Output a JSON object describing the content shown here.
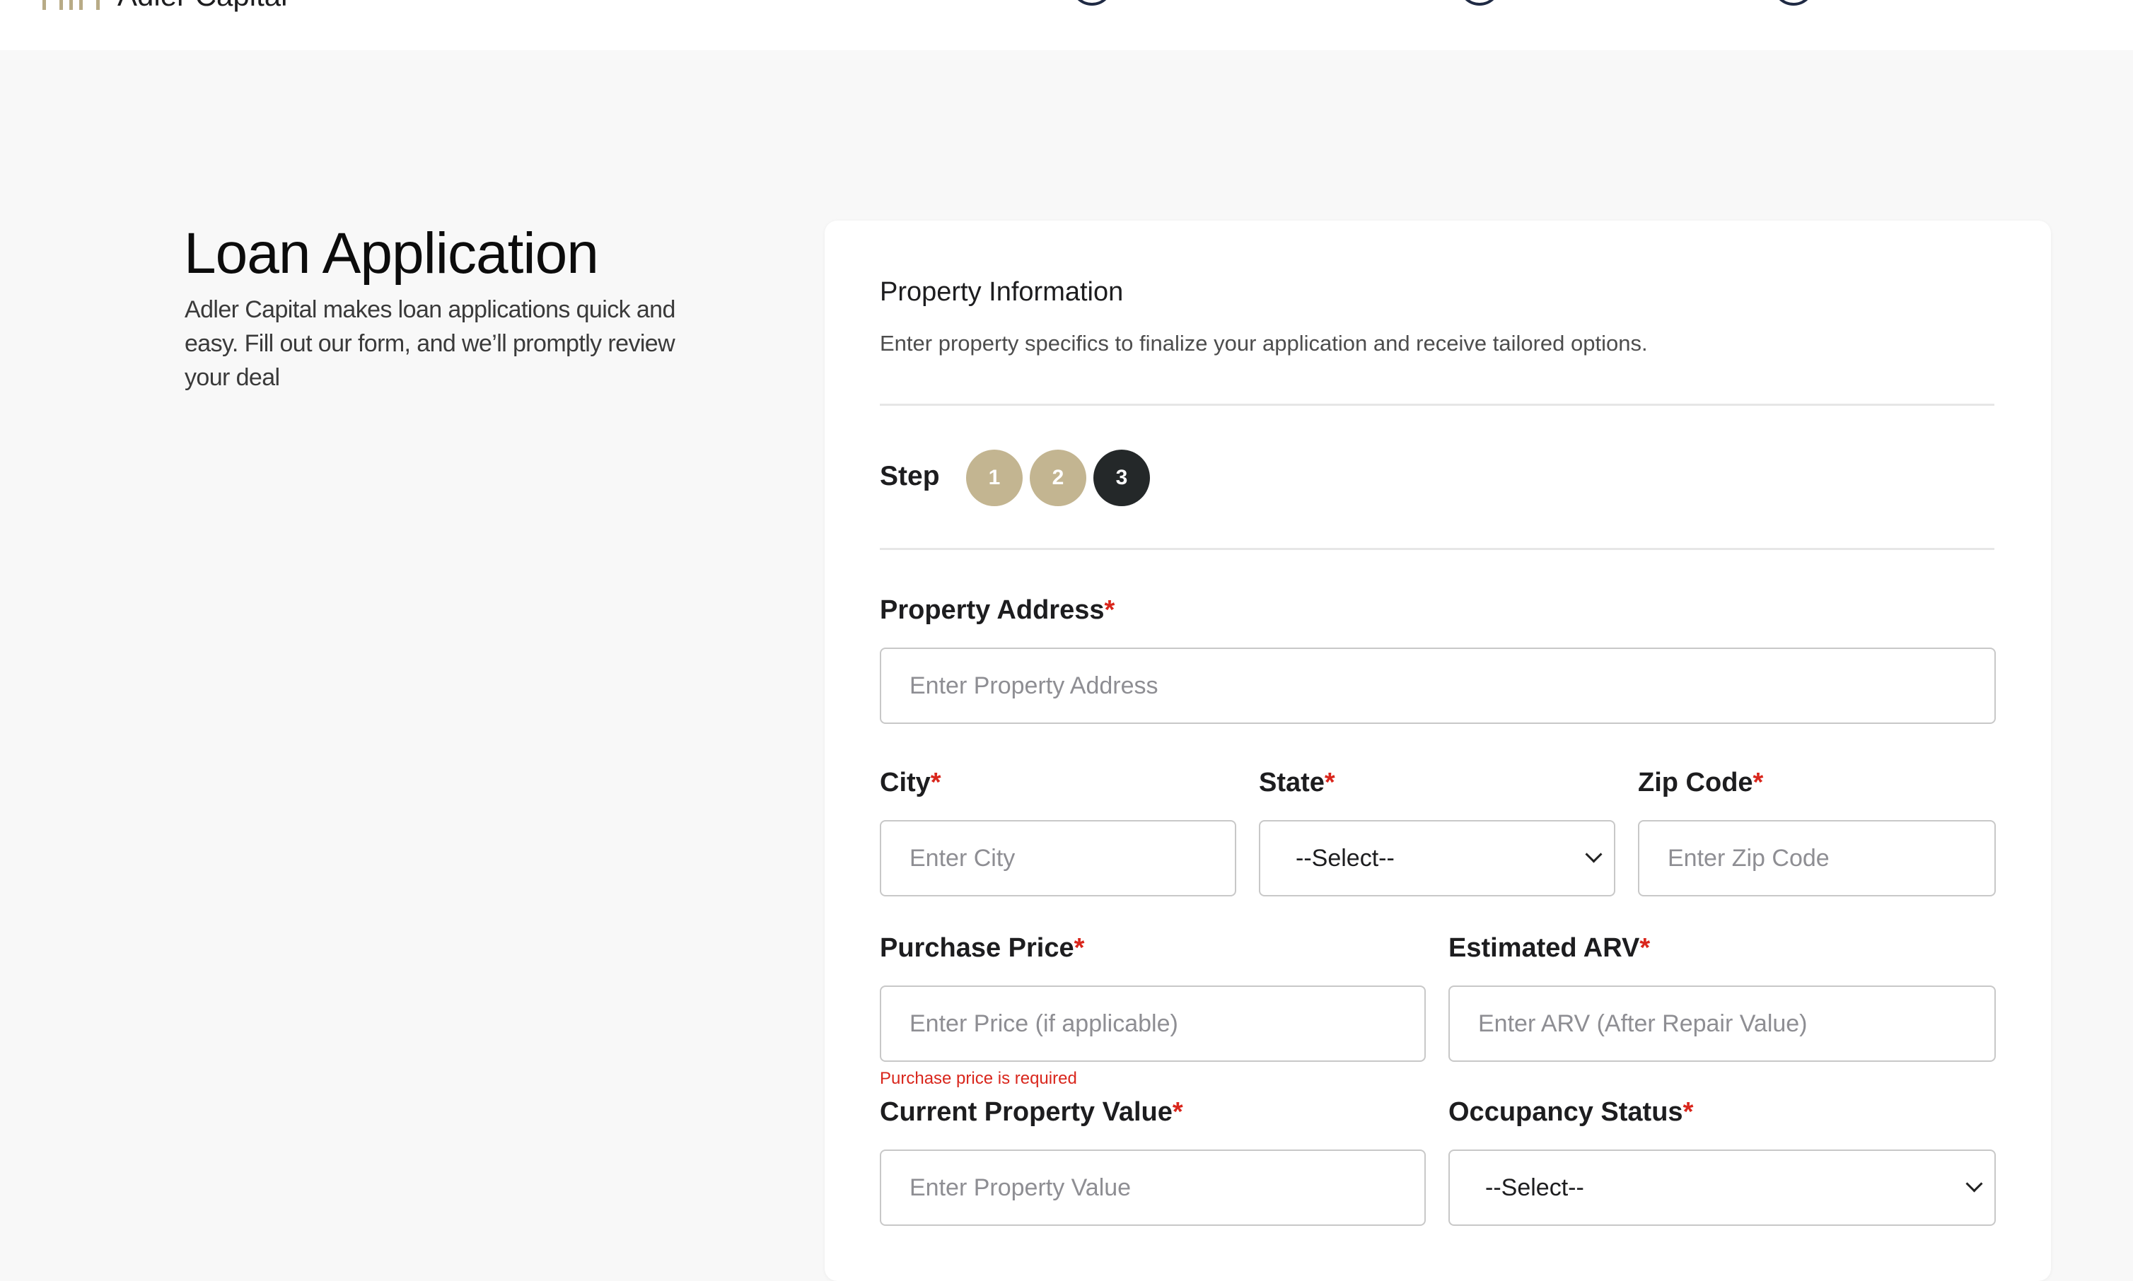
{
  "header": {
    "brand": "Adler Capital"
  },
  "intro": {
    "title": "Loan Application",
    "description": "Adler Capital makes loan applications quick and easy. Fill out our form, and we’ll promptly review your deal"
  },
  "form": {
    "section_title": "Property Information",
    "section_description": "Enter property specifics to finalize your application and receive tailored options.",
    "step_label": "Step",
    "steps": [
      "1",
      "2",
      "3"
    ],
    "current_step": 3,
    "required_marker": "*",
    "property_address": {
      "label": "Property Address",
      "placeholder": "Enter Property Address"
    },
    "city": {
      "label": "City",
      "placeholder": "Enter City"
    },
    "state": {
      "label": "State",
      "selected": "--Select--"
    },
    "zip": {
      "label": "Zip Code",
      "placeholder": "Enter Zip Code"
    },
    "purchase_price": {
      "label": "Purchase Price",
      "placeholder": "Enter Price (if applicable)",
      "error": "Purchase price is required"
    },
    "arv": {
      "label": "Estimated ARV",
      "placeholder": "Enter ARV (After Repair Value)"
    },
    "current_value": {
      "label": "Current Property Value",
      "placeholder": "Enter Property Value"
    },
    "occupancy": {
      "label": "Occupancy Status",
      "selected": "--Select--"
    }
  },
  "colors": {
    "accent_gold": "#c3b591",
    "active_step": "#242829",
    "required": "#d9261c"
  }
}
